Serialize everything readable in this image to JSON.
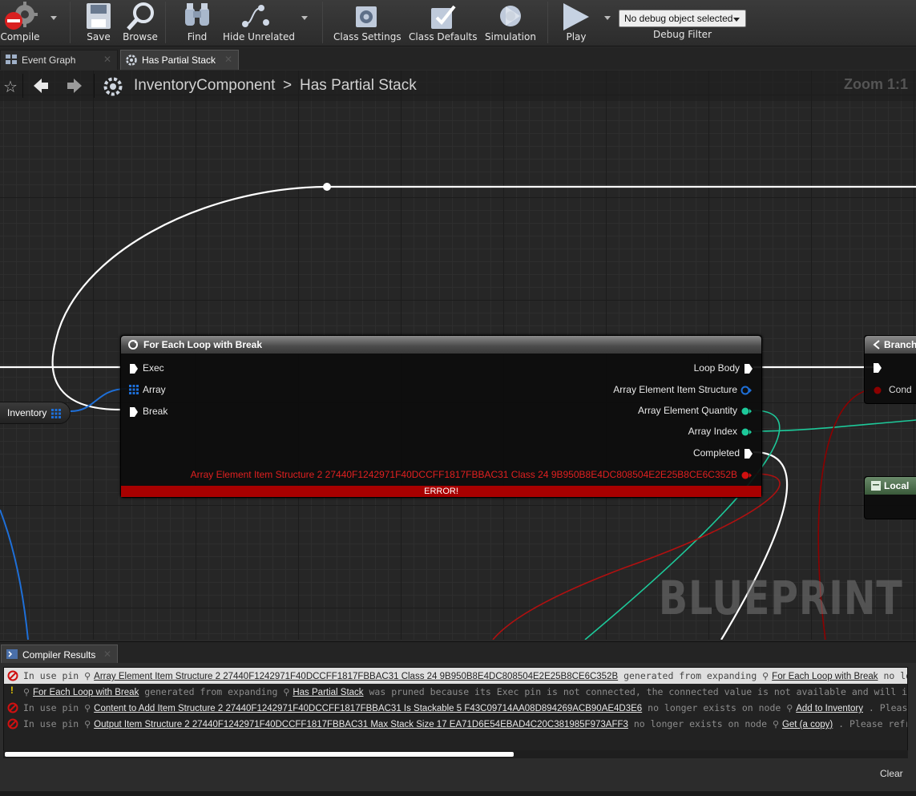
{
  "toolbar": {
    "compile": "Compile",
    "save": "Save",
    "browse": "Browse",
    "find": "Find",
    "hide_unrelated": "Hide Unrelated",
    "class_settings": "Class Settings",
    "class_defaults": "Class Defaults",
    "simulation": "Simulation",
    "play": "Play",
    "debug_select": "No debug object selected",
    "debug_filter": "Debug Filter"
  },
  "tabs": [
    {
      "label": "Event Graph"
    },
    {
      "label": "Has Partial Stack"
    }
  ],
  "breadcrumb": {
    "root": "InventoryComponent",
    "separator": ">",
    "current": "Has Partial Stack",
    "zoom": "Zoom 1:1"
  },
  "node": {
    "title": "For Each Loop with Break",
    "inputs": [
      "Exec",
      "Array",
      "Break"
    ],
    "outputs": [
      "Loop Body",
      "Array Element Item Structure",
      "Array Element Quantity",
      "Array Index",
      "Completed"
    ],
    "error_pin": "Array Element Item Structure 2 27440F1242971F40DCCFF1817FBBAC31 Class 24 9B950B8E4DC808504E2E25B8CE6C352B",
    "error_label": "ERROR!"
  },
  "var_node": {
    "label": "Inventory"
  },
  "branch_node": {
    "title": "Branch",
    "cond": "Cond"
  },
  "local_node": {
    "title": "Local"
  },
  "watermark": "BLUEPRINT",
  "compiler": {
    "tab": "Compiler Results",
    "clear": "Clear",
    "rows": [
      {
        "severity": "error",
        "parts": [
          "In use pin ",
          "Array Element Item Structure 2 27440F1242971F40DCCFF1817FBBAC31 Class 24 9B950B8E4DC808504E2E25B8CE6C352B",
          " generated from expanding ",
          "For Each Loop with Break",
          "  no longer exists on node"
        ]
      },
      {
        "severity": "warning",
        "parts": [
          "",
          "For Each Loop with Break",
          " generated from expanding ",
          "Has Partial Stack",
          "  was pruned because its Exec pin is not connected, the connected value is not available and will instead be read as default"
        ]
      },
      {
        "severity": "error",
        "parts": [
          "In use pin ",
          "Content to Add Item Structure 2 27440F1242971F40DCCFF1817FBBAC31 Is Stackable 5 F43C09714AA08D894269ACB90AE4D3E6",
          "  no longer exists on node ",
          "Add to Inventory",
          " . Please refresh node or break links to remove pin."
        ]
      },
      {
        "severity": "error",
        "parts": [
          "In use pin ",
          "Output Item Structure 2 27440F1242971F40DCCFF1817FBBAC31 Max Stack Size 17 EA71D6E54EBAD4C20C381985F973AFF3",
          "  no longer exists on node ",
          "Get (a copy)",
          " . Please refresh node or break links to remove pin."
        ]
      }
    ]
  },
  "colors": {
    "exec": "#ffffff",
    "struct": "#0a5fc0",
    "int": "#1dc99a",
    "bool": "#8c0000",
    "error": "#a80000"
  }
}
